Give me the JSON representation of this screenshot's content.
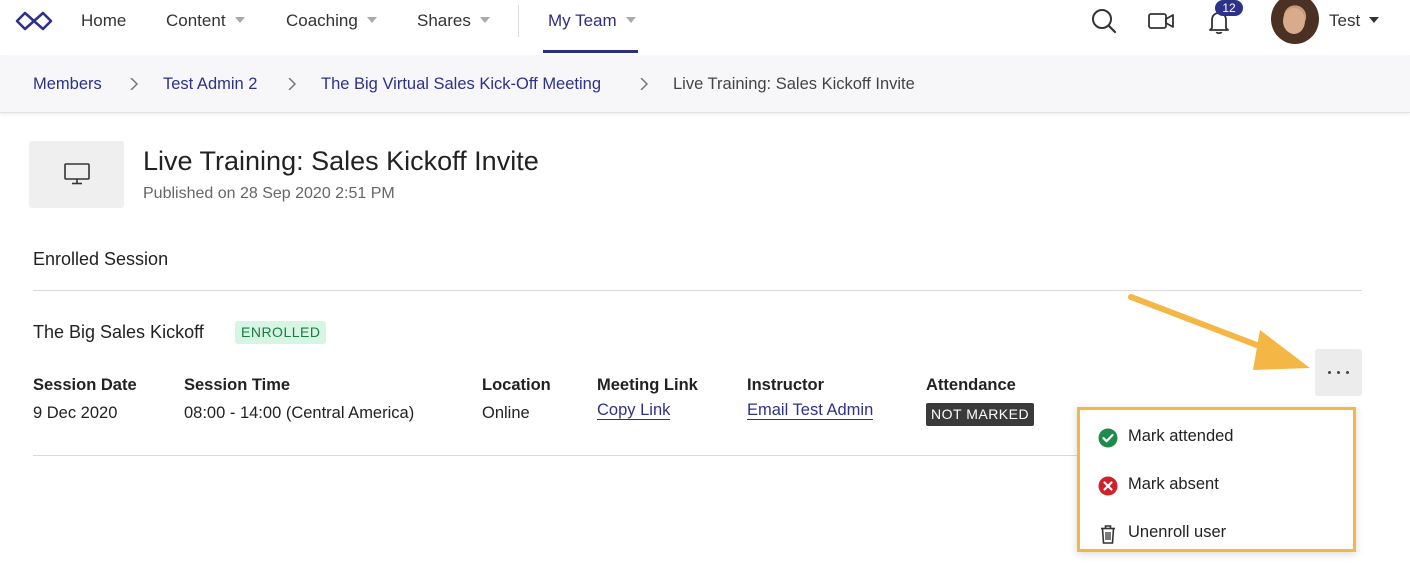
{
  "nav": {
    "home": "Home",
    "content": "Content",
    "coaching": "Coaching",
    "shares": "Shares",
    "my_team": "My Team",
    "notification_count": "12",
    "user_name": "Test"
  },
  "breadcrumb": {
    "items": [
      "Members",
      "Test Admin 2",
      "The Big Virtual Sales Kick-Off Meeting"
    ],
    "current": "Live Training: Sales Kickoff Invite"
  },
  "header": {
    "title": "Live Training: Sales Kickoff Invite",
    "published": "Published on 28 Sep 2020 2:51 PM"
  },
  "section": {
    "title": "Enrolled Session"
  },
  "session": {
    "name": "The Big Sales Kickoff",
    "status_badge": "ENROLLED",
    "columns": {
      "date_label": "Session Date",
      "date_value": "9 Dec 2020",
      "time_label": "Session Time",
      "time_value": "08:00 - 14:00 (Central America)",
      "location_label": "Location",
      "location_value": "Online",
      "meeting_label": "Meeting Link",
      "meeting_value": "Copy Link",
      "instructor_label": "Instructor",
      "instructor_value": "Email Test Admin",
      "attendance_label": "Attendance",
      "attendance_value": "NOT MARKED"
    }
  },
  "menu": {
    "items": [
      {
        "label": "Mark attended",
        "icon": "check-circle-icon"
      },
      {
        "label": "Mark absent",
        "icon": "x-circle-icon"
      },
      {
        "label": "Unenroll user",
        "icon": "trash-icon"
      }
    ]
  },
  "colors": {
    "brand": "#2e3188",
    "success": "#1e8a4c",
    "danger": "#d0202a",
    "highlight": "#f4b746"
  }
}
